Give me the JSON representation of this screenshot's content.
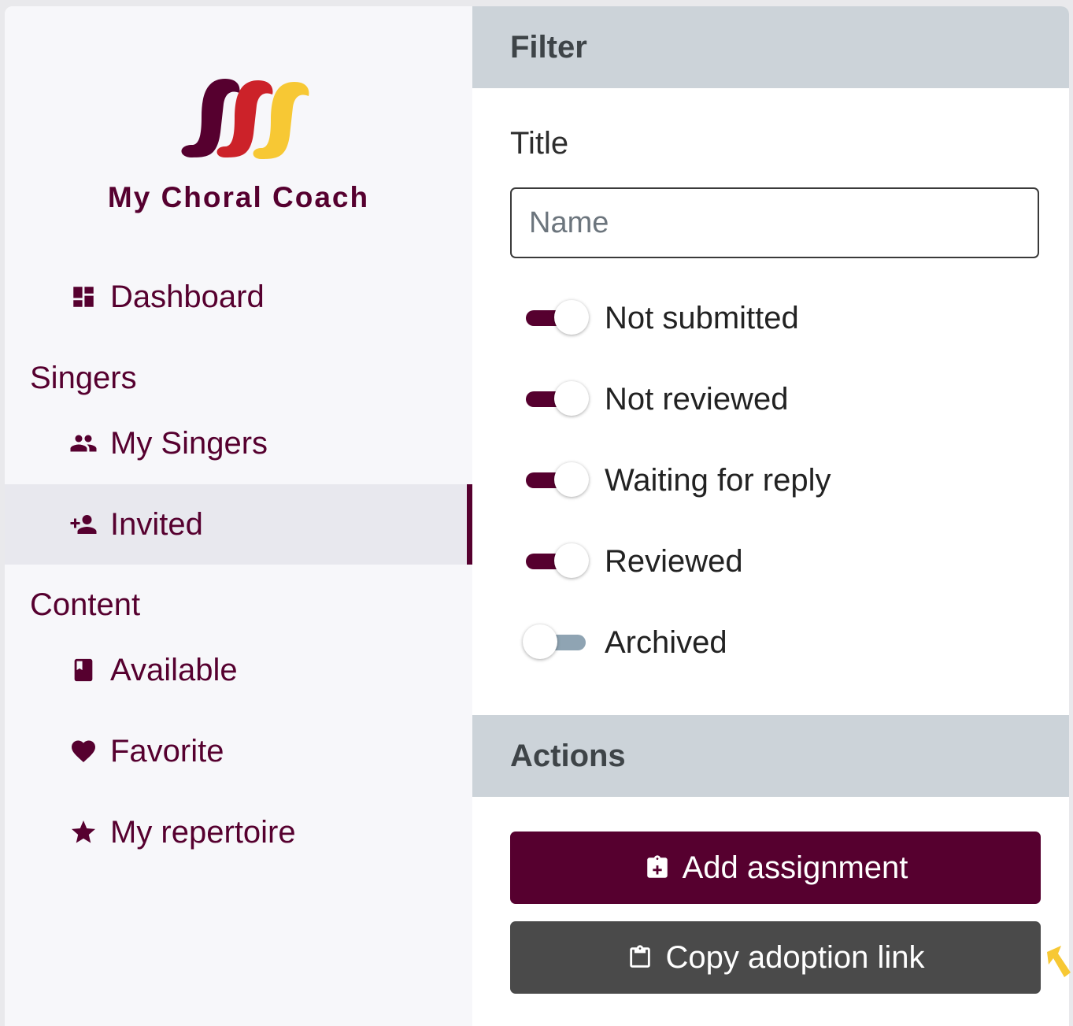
{
  "brand": {
    "name": "My Choral Coach",
    "logo_colors": [
      "#56002f",
      "#cc2229",
      "#f7c834"
    ]
  },
  "nav": {
    "dashboard": {
      "label": "Dashboard",
      "icon": "dashboard-icon"
    },
    "singers_heading": "Singers",
    "my_singers": {
      "label": "My Singers",
      "icon": "people-icon"
    },
    "invited": {
      "label": "Invited",
      "icon": "person-add-icon",
      "active": true
    },
    "content_heading": "Content",
    "available": {
      "label": "Available",
      "icon": "book-icon"
    },
    "favorite": {
      "label": "Favorite",
      "icon": "heart-icon"
    },
    "my_repertoire": {
      "label": "My repertoire",
      "icon": "star-icon"
    }
  },
  "filter": {
    "heading": "Filter",
    "title_label": "Title",
    "title_placeholder": "Name",
    "title_value": "",
    "toggles": [
      {
        "label": "Not submitted",
        "on": true
      },
      {
        "label": "Not reviewed",
        "on": true
      },
      {
        "label": "Waiting for reply",
        "on": true
      },
      {
        "label": "Reviewed",
        "on": true
      },
      {
        "label": "Archived",
        "on": false
      }
    ]
  },
  "actions": {
    "heading": "Actions",
    "add_assignment": "Add assignment",
    "copy_adoption_link": "Copy adoption link"
  },
  "colors": {
    "accent": "#56002f",
    "header_bg": "#ccd3d9",
    "secondary_button": "#4a4a4a",
    "toggle_off": "#8fa4b3",
    "cursor": "#f7c834"
  }
}
